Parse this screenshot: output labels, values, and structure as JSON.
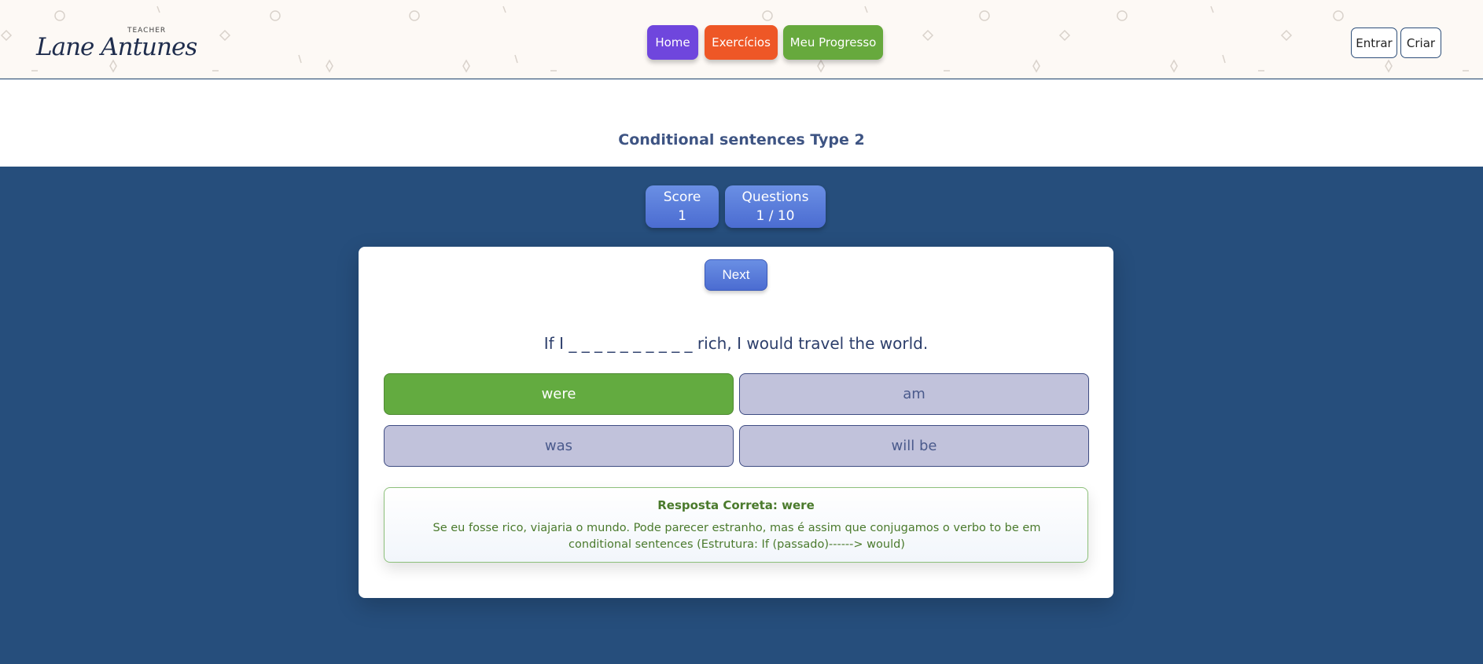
{
  "header": {
    "logo": {
      "small": "TEACHER",
      "main": "Lane Antunes"
    },
    "nav": [
      {
        "label": "Home"
      },
      {
        "label": "Exercícios"
      },
      {
        "label": "Meu Progresso"
      }
    ],
    "auth": {
      "login": "Entrar",
      "signup": "Criar"
    }
  },
  "page": {
    "title": "Conditional sentences Type 2"
  },
  "stats": {
    "score_label": "Score",
    "score_value": "1",
    "questions_label": "Questions",
    "questions_value": "1 / 10"
  },
  "quiz": {
    "next_label": "Next",
    "question": "If I _ _ _ _ _ _ _ _ _ _ rich, I would travel the world.",
    "options": [
      {
        "label": "were",
        "state": "correct"
      },
      {
        "label": "am",
        "state": "neutral"
      },
      {
        "label": "was",
        "state": "neutral"
      },
      {
        "label": "will be",
        "state": "neutral"
      }
    ],
    "feedback": {
      "title": "Resposta Correta: were",
      "text": "Se eu fosse rico, viajaria o mundo. Pode parecer estranho, mas é assim que conjugamos o verbo to be em conditional sentences (Estrutura: If (passado)------> would)"
    }
  },
  "colors": {
    "background": "#264e7c",
    "home": "#6f46dd",
    "exercises": "#ee5726",
    "progress": "#67a93d",
    "correct": "#63ab40",
    "option": "#c1c2db",
    "stat": "#5b7ddb"
  }
}
